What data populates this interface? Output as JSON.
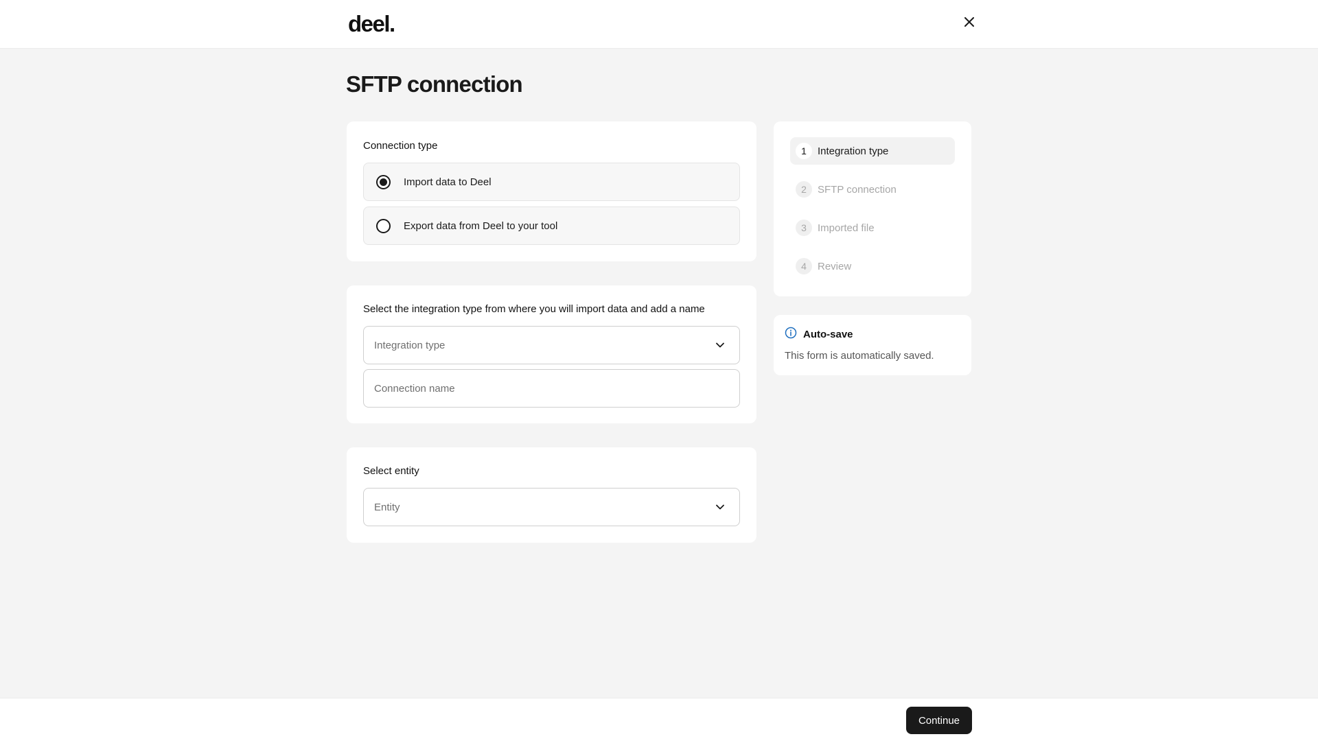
{
  "header": {
    "logo_text": "deel.",
    "close_icon": "close-icon"
  },
  "page": {
    "title": "SFTP connection"
  },
  "connection_type": {
    "title": "Connection type",
    "options": [
      {
        "label": "Import data to Deel",
        "selected": true
      },
      {
        "label": "Export data from Deel to your tool",
        "selected": false
      }
    ]
  },
  "integration": {
    "title": "Select the integration type from where you will import data and add a name",
    "integration_type_placeholder": "Integration type",
    "connection_name_placeholder": "Connection name"
  },
  "entity": {
    "title": "Select entity",
    "entity_placeholder": "Entity"
  },
  "steps": [
    {
      "number": "1",
      "label": "Integration type",
      "active": true
    },
    {
      "number": "2",
      "label": "SFTP connection",
      "active": false
    },
    {
      "number": "3",
      "label": "Imported file",
      "active": false
    },
    {
      "number": "4",
      "label": "Review",
      "active": false
    }
  ],
  "autosave": {
    "icon": "info-icon",
    "title": "Auto-save",
    "text": "This form is automatically saved."
  },
  "footer": {
    "continue_label": "Continue"
  },
  "colors": {
    "background": "#f4f4f4",
    "primary_button": "#1a1a1a",
    "info_icon": "#1f6fbf"
  }
}
